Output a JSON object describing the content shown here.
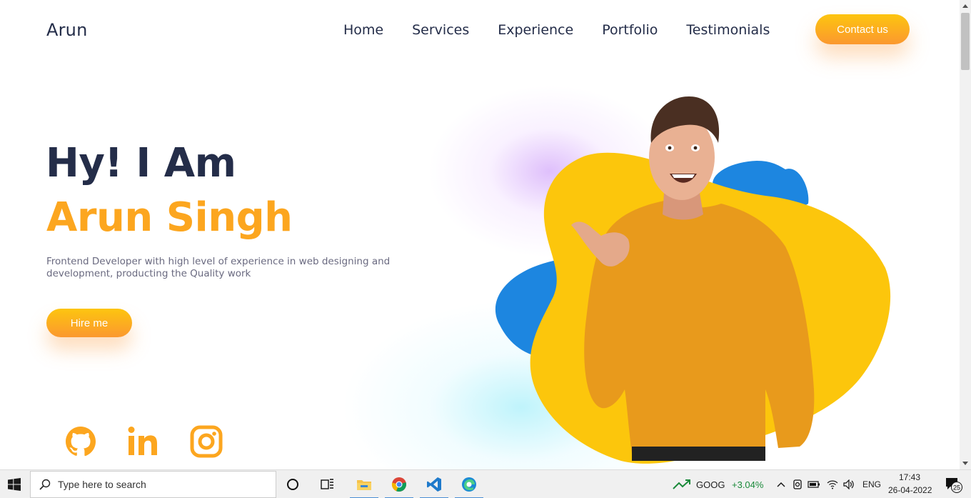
{
  "nav": {
    "logo": "Arun",
    "items": [
      "Home",
      "Services",
      "Experience",
      "Portfolio",
      "Testimonials"
    ],
    "contact_label": "Contact us"
  },
  "hero": {
    "greeting": "Hy! I Am",
    "name": "Arun Singh",
    "description": "Frontend Developer with high level of experience in web designing and development, producting the Quality work",
    "hire_label": "Hire me",
    "socials": [
      "github-icon",
      "linkedin-icon",
      "instagram-icon"
    ]
  },
  "colors": {
    "accent": "#fca61f",
    "dark": "#242d49",
    "blob_yellow": "#fcc60c",
    "blob_blue": "#1d86e0"
  },
  "taskbar": {
    "search_placeholder": "Type here to search",
    "apps": [
      "cortana-icon",
      "task-view-icon",
      "file-explorer-icon",
      "chrome-icon",
      "vscode-icon",
      "edge-icon"
    ],
    "stock_name": "GOOG",
    "stock_change": "+3.04%",
    "language": "ENG",
    "time": "17:43",
    "date": "26-04-2022",
    "notification_count": "25"
  }
}
